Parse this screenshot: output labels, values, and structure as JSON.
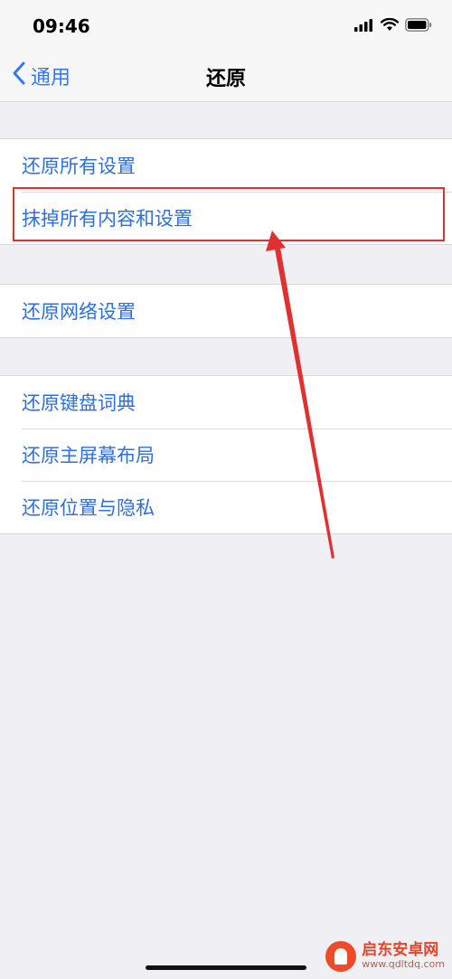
{
  "status_bar": {
    "time": "09:46",
    "icons": [
      "signal-icon",
      "wifi-icon",
      "battery-icon"
    ]
  },
  "nav": {
    "back_label": "通用",
    "title": "还原"
  },
  "groups": [
    {
      "items": [
        {
          "label": "还原所有设置"
        },
        {
          "label": "抹掉所有内容和设置"
        }
      ]
    },
    {
      "items": [
        {
          "label": "还原网络设置"
        }
      ]
    },
    {
      "items": [
        {
          "label": "还原键盘词典"
        },
        {
          "label": "还原主屏幕布局"
        },
        {
          "label": "还原位置与隐私"
        }
      ]
    }
  ],
  "watermark": {
    "title": "启东安卓网",
    "url": "www.qdltdq.com"
  },
  "colors": {
    "accent": "#3478f6",
    "row_text": "#2f6fdd",
    "annotation": "#e03030",
    "background": "#efeff4"
  }
}
